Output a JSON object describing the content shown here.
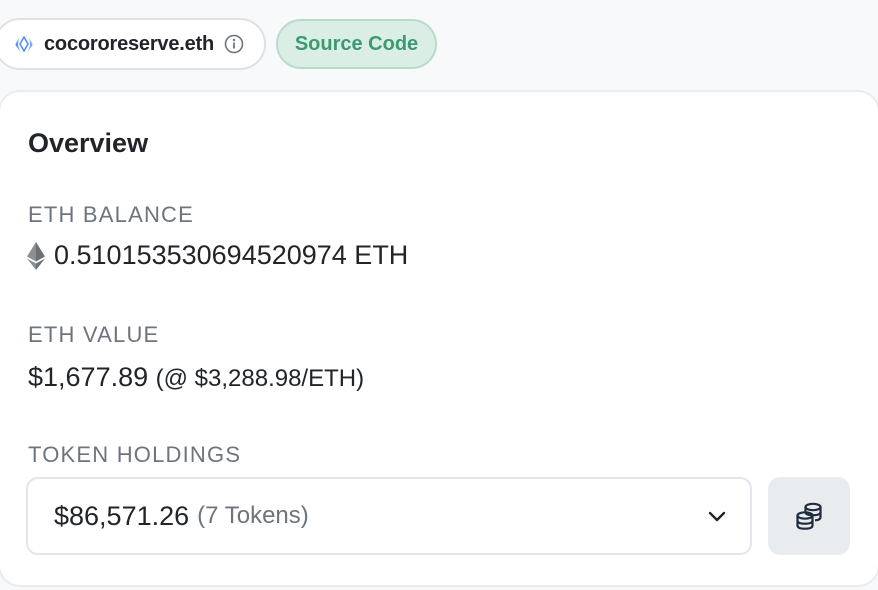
{
  "header": {
    "ens_name": "cocororeserve.eth",
    "source_code_label": "Source Code"
  },
  "overview": {
    "title": "Overview",
    "eth_balance": {
      "label": "ETH BALANCE",
      "value": "0.510153530694520974 ETH"
    },
    "eth_value": {
      "label": "ETH VALUE",
      "amount": "$1,677.89",
      "rate": "(@ $3,288.98/ETH)"
    },
    "token_holdings": {
      "label": "TOKEN HOLDINGS",
      "amount": "$86,571.26",
      "count": "(7 Tokens)"
    }
  },
  "icons": {
    "ens": "ens-logo-icon",
    "info": "info-icon",
    "eth": "ethereum-icon",
    "chevron": "chevron-down-icon",
    "coins": "coins-stack-icon"
  },
  "colors": {
    "source_code_bg": "#dbeee5",
    "source_code_text": "#3c9a73",
    "ens_blue": "#5298ff",
    "muted_text": "#6c757d"
  }
}
